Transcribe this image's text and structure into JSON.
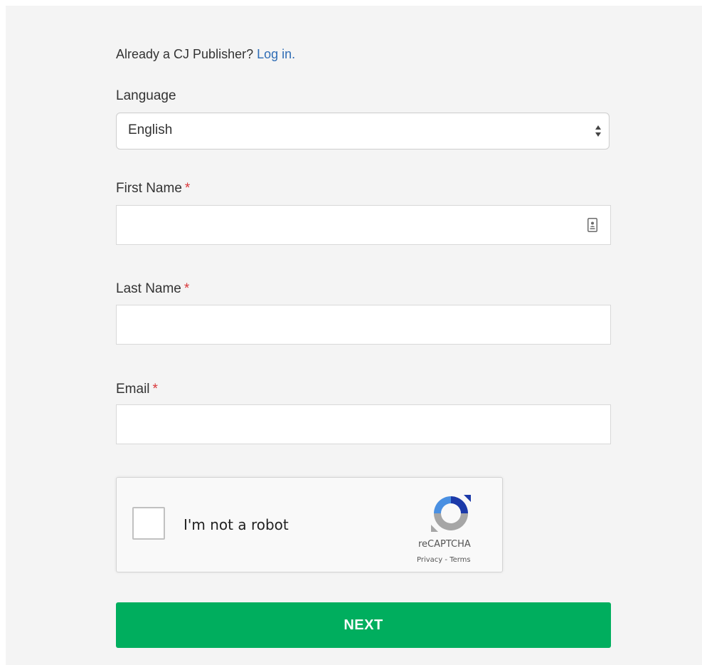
{
  "already": {
    "text": "Already a CJ Publisher?",
    "login_link": "Log in."
  },
  "language": {
    "label": "Language",
    "selected": "English"
  },
  "first_name": {
    "label": "First Name",
    "required_mark": "*",
    "value": ""
  },
  "last_name": {
    "label": "Last Name",
    "required_mark": "*",
    "value": ""
  },
  "email": {
    "label": "Email",
    "required_mark": "*",
    "value": ""
  },
  "recaptcha": {
    "checkbox_label": "I'm not a robot",
    "brand": "reCAPTCHA",
    "privacy_link": "Privacy",
    "separator": " - ",
    "terms_link": "Terms"
  },
  "next_button": {
    "label": "NEXT"
  },
  "colors": {
    "accent_green": "#00ae5e",
    "link_blue": "#2f6db5",
    "required_red": "#d9373a",
    "panel_bg": "#f4f4f4"
  },
  "icons": {
    "select_arrows": "up-down-arrows-icon",
    "contact_card": "contact-card-icon",
    "recaptcha_logo": "recaptcha-logo-icon"
  }
}
